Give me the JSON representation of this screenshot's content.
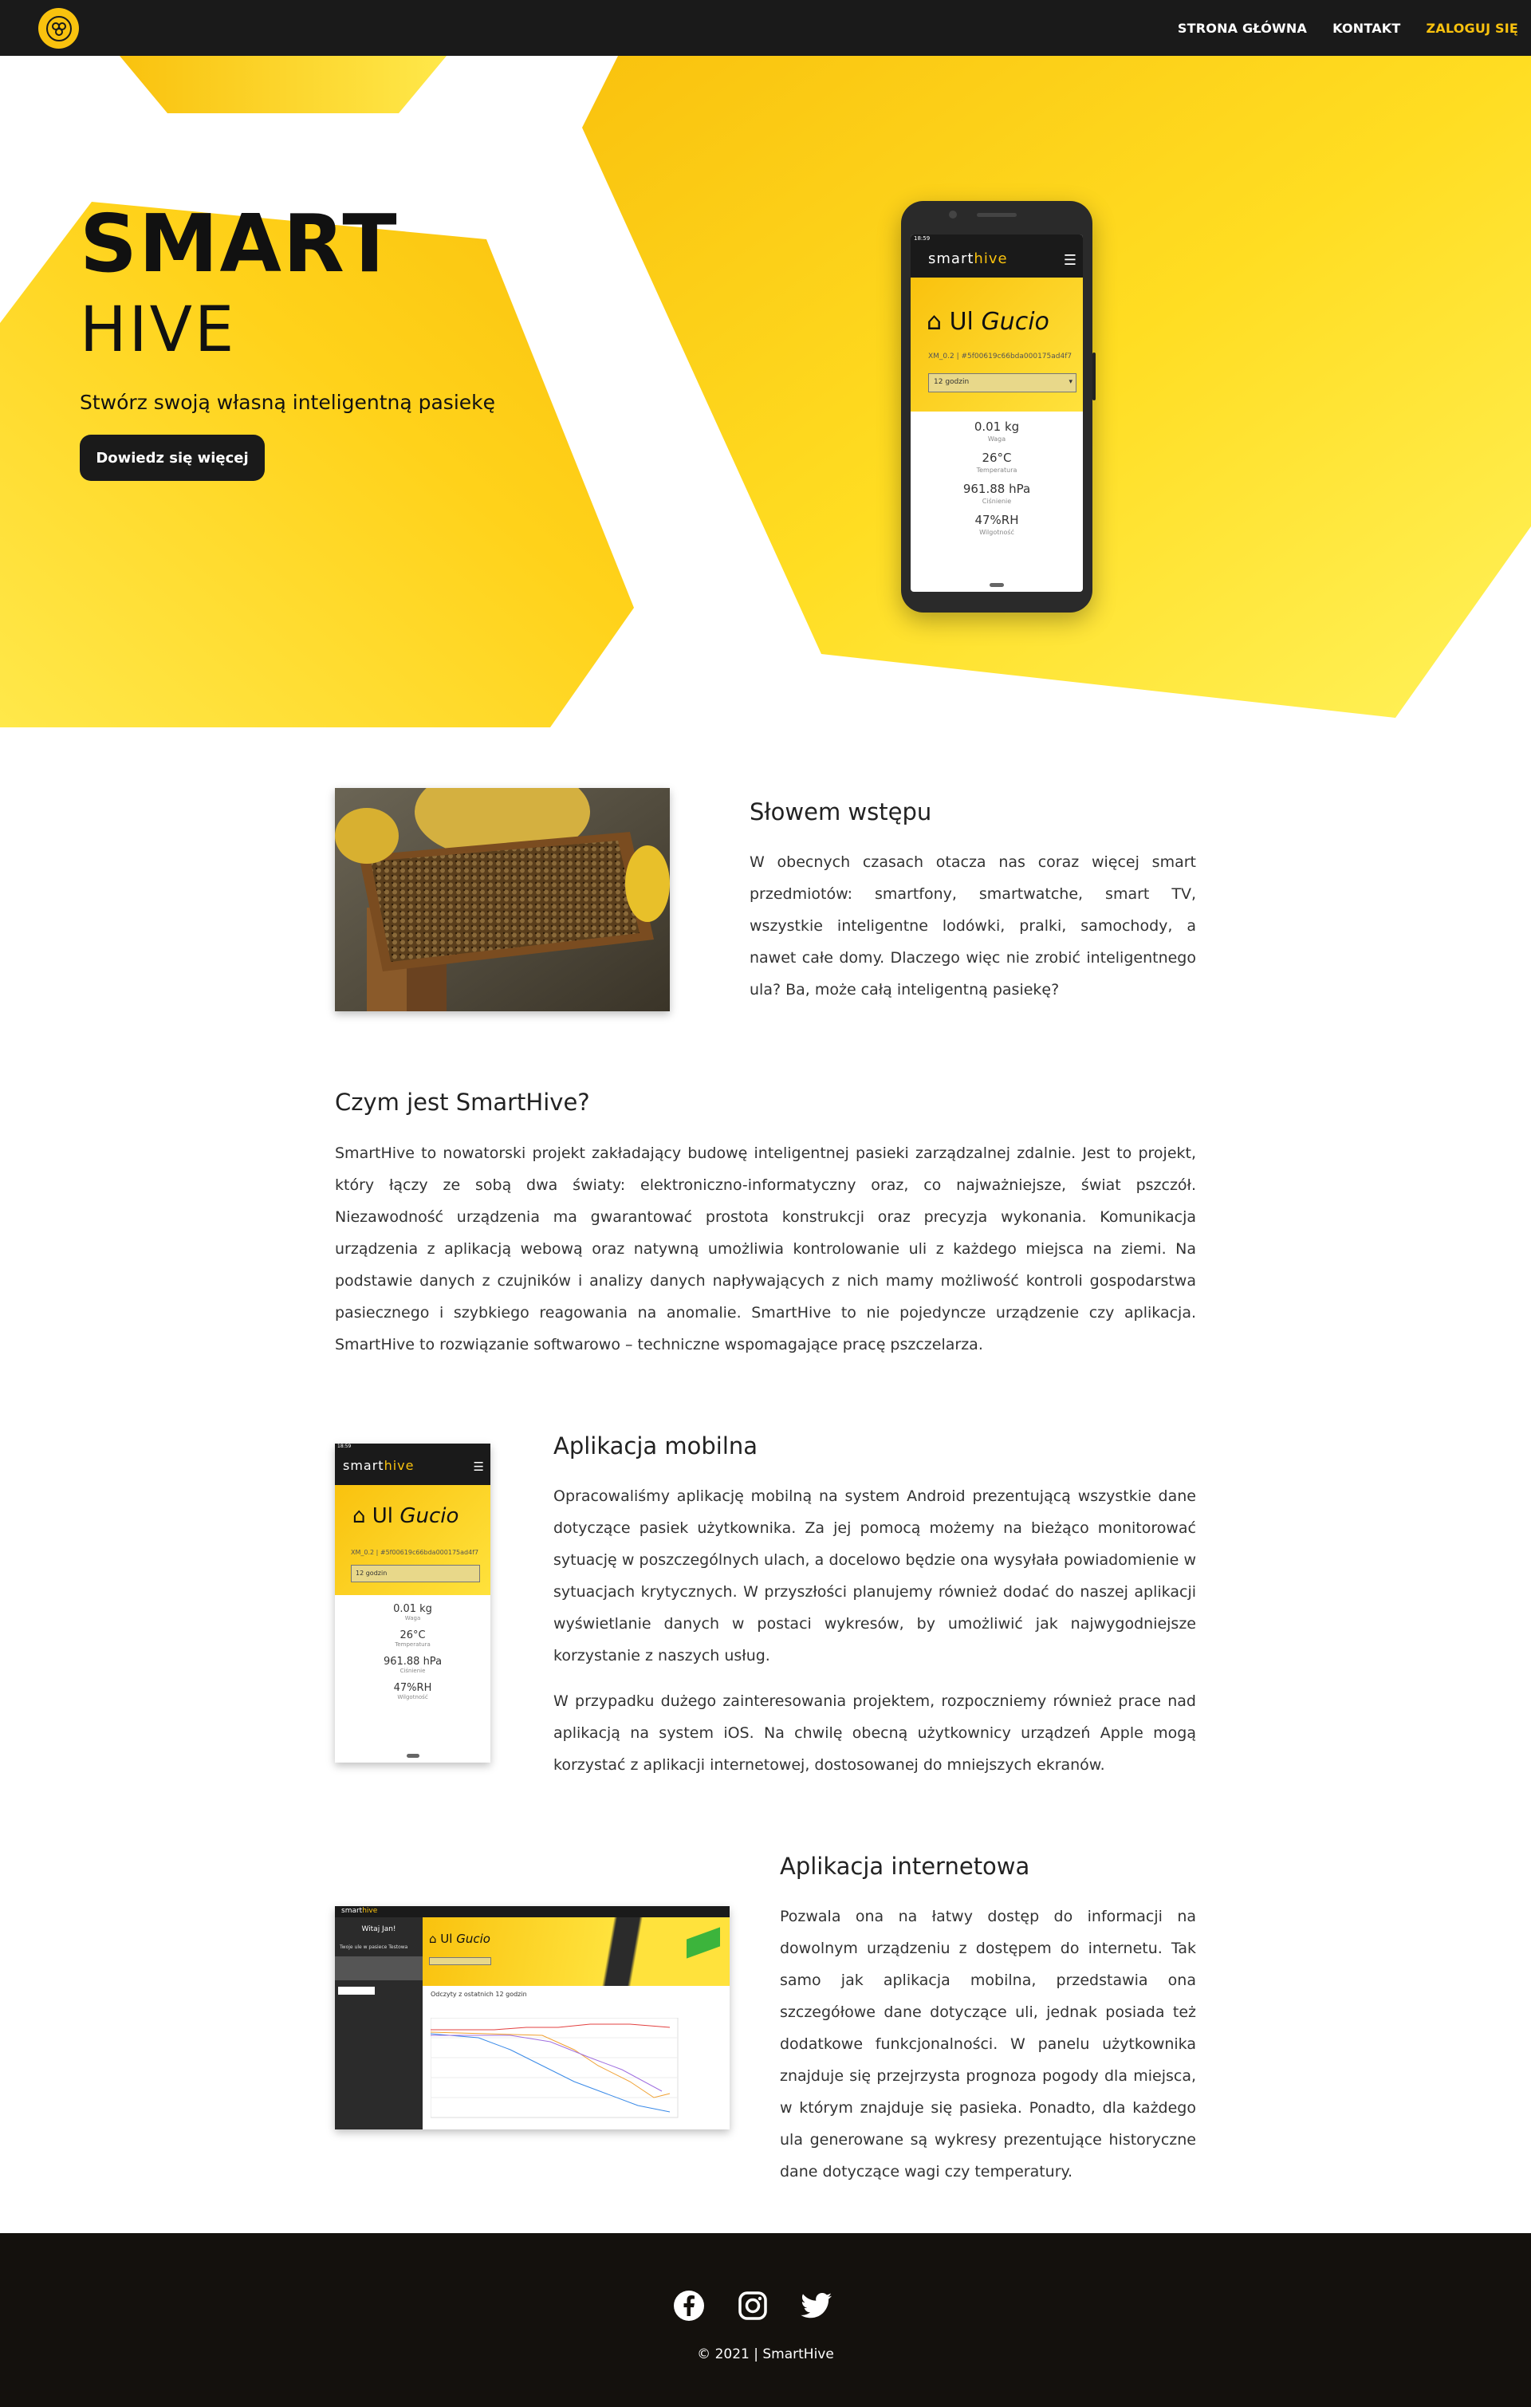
{
  "navbar": {
    "logo_icon": "bee-hive-logo-icon",
    "links": [
      {
        "label": "STRONA GŁÓWNA"
      },
      {
        "label": "KONTAKT"
      },
      {
        "label": "ZALOGUJ SIĘ"
      }
    ],
    "accent_color": "#f9c20e"
  },
  "hero": {
    "title_line1": "SMART",
    "title_line2": "HIVE",
    "subtitle": "Stwórz swoją własną inteligentną pasiekę",
    "cta_label": "Dowiedz się więcej",
    "phone": {
      "status_time": "18:59",
      "brand_left": "smart",
      "brand_right": "hive",
      "hive_label": "Ul",
      "hive_name": "Gucio",
      "hive_id": "XM_0.2 | #5f00619c66bda000175ad4f7",
      "period_select": "12 godzin",
      "metrics": [
        {
          "value": "0.01 kg",
          "label": "Waga"
        },
        {
          "value": "26°C",
          "label": "Temperatura"
        },
        {
          "value": "961.88 hPa",
          "label": "Ciśnienie"
        },
        {
          "value": "47%RH",
          "label": "Wilgotność"
        }
      ]
    }
  },
  "intro": {
    "title": "Słowem wstępu",
    "text": "W obecnych czasach otacza nas coraz więcej smart przedmiotów: smartfony, smartwatche, smart TV, wszystkie inteligentne lodówki, pralki, samochody, a nawet całe domy. Dlaczego więc nie zrobić inteligentnego ula? Ba, może całą inteligentną pasiekę?"
  },
  "about": {
    "title": "Czym jest SmartHive?",
    "text": "SmartHive to nowatorski projekt zakładający budowę inteligentnej pasieki zarządzalnej zdalnie. Jest to projekt, który łączy ze sobą dwa światy: elektroniczno-informatyczny oraz, co najważniejsze, świat pszczół. Niezawodność urządzenia ma gwarantować prostota konstrukcji oraz precyzja wykonania. Komunikacja urządzenia z aplikacją webową oraz natywną umożliwia kontrolowanie uli z każdego miejsca na ziemi. Na podstawie danych z czujników i analizy danych napływających z nich mamy możliwość kontroli gospodarstwa pasiecznego i szybkiego reagowania na anomalie. SmartHive to nie pojedyncze urządzenie czy aplikacja. SmartHive to rozwiązanie softwarowo – techniczne wspomagające pracę pszczelarza."
  },
  "mobile": {
    "title": "Aplikacja mobilna",
    "text1": "Opracowaliśmy aplikację mobilną na system Android prezentującą wszystkie dane dotyczące pasiek użytkownika. Za jej pomocą możemy na bieżąco monitorować sytuację w poszczególnych ulach, a docelowo będzie ona wysyłała powiadomienie w sytuacjach krytycznych. W przyszłości planujemy również dodać do naszej aplikacji wyświetlanie danych w postaci wykresów, by umożliwić jak najwygodniejsze korzystanie z naszych usług.",
    "text2": "W przypadku dużego zainteresowania projektem, rozpoczniemy również prace nad aplikacją na system iOS. Na chwilę obecną użytkownicy urządzeń Apple mogą korzystać z aplikacji internetowej, dostosowanej do mniejszych ekranów."
  },
  "web": {
    "title": "Aplikacja internetowa",
    "text": "Pozwala ona na łatwy dostęp do informacji na dowolnym urządzeniu z dostępem do internetu. Tak samo jak aplikacja mobilna, przedstawia ona szczegółowe dane dotyczące uli, jednak posiada też dodatkowe funkcjonalności. W panelu użytkownika znajduje się przejrzysta prognoza pogody dla miejsca, w którym znajduje się pasieka. Ponadto, dla każdego ula generowane są wykresy prezentujące historyczne dane dotyczące wagi czy temperatury.",
    "screenshot": {
      "sidebar_title": "Witaj Jan!",
      "sidebar_sub": "Twoje ule w pasiece Testowa",
      "chart_title": "Odczyty z ostatnich 12 godzin"
    }
  },
  "footer": {
    "social": [
      "facebook-icon",
      "instagram-icon",
      "twitter-icon"
    ],
    "copyright": "© 2021 | SmartHive"
  }
}
